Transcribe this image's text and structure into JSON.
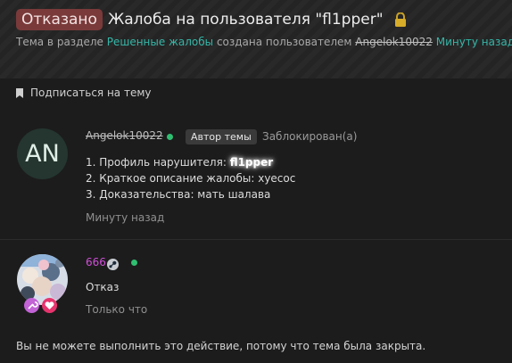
{
  "header": {
    "status_badge": "Отказано",
    "thread_title": "Жалоба на пользователя \"fl1pper\"",
    "meta": {
      "prefix": "Тема в разделе ",
      "section_link": "Решенные жалобы",
      "middle": " создана пользователем ",
      "author": "Angelok10022",
      "time": "Минуту назад",
      "suffix": "."
    }
  },
  "subscribe_label": "Подписаться на тему",
  "posts": [
    {
      "avatar_initials": "AN",
      "username": "Angelok10022",
      "author_badge": "Автор темы",
      "status": "Заблокирован(а)",
      "line1_prefix": "1. Профиль нарушителя: ",
      "line1_value": "fl1pper",
      "line2": "2. Краткое описание жалобы: хуесос",
      "line3": "3. Доказательства: мать шалава",
      "time": "Минуту назад"
    },
    {
      "username": "666",
      "text": "Отказ",
      "time": "Только что"
    }
  ],
  "closed_notice": "Вы не можете выполнить это действие, потому что тема была закрыта.",
  "colors": {
    "accent_link": "#35b6a8",
    "status_badge_bg": "#7a3a3a",
    "online": "#2fbf71",
    "username_666": "#cf4fd8"
  },
  "icons": [
    "lock-icon",
    "bookmark-icon",
    "steam-icon",
    "online-dot-icon",
    "wrench-badge-icon",
    "heart-badge-icon"
  ]
}
